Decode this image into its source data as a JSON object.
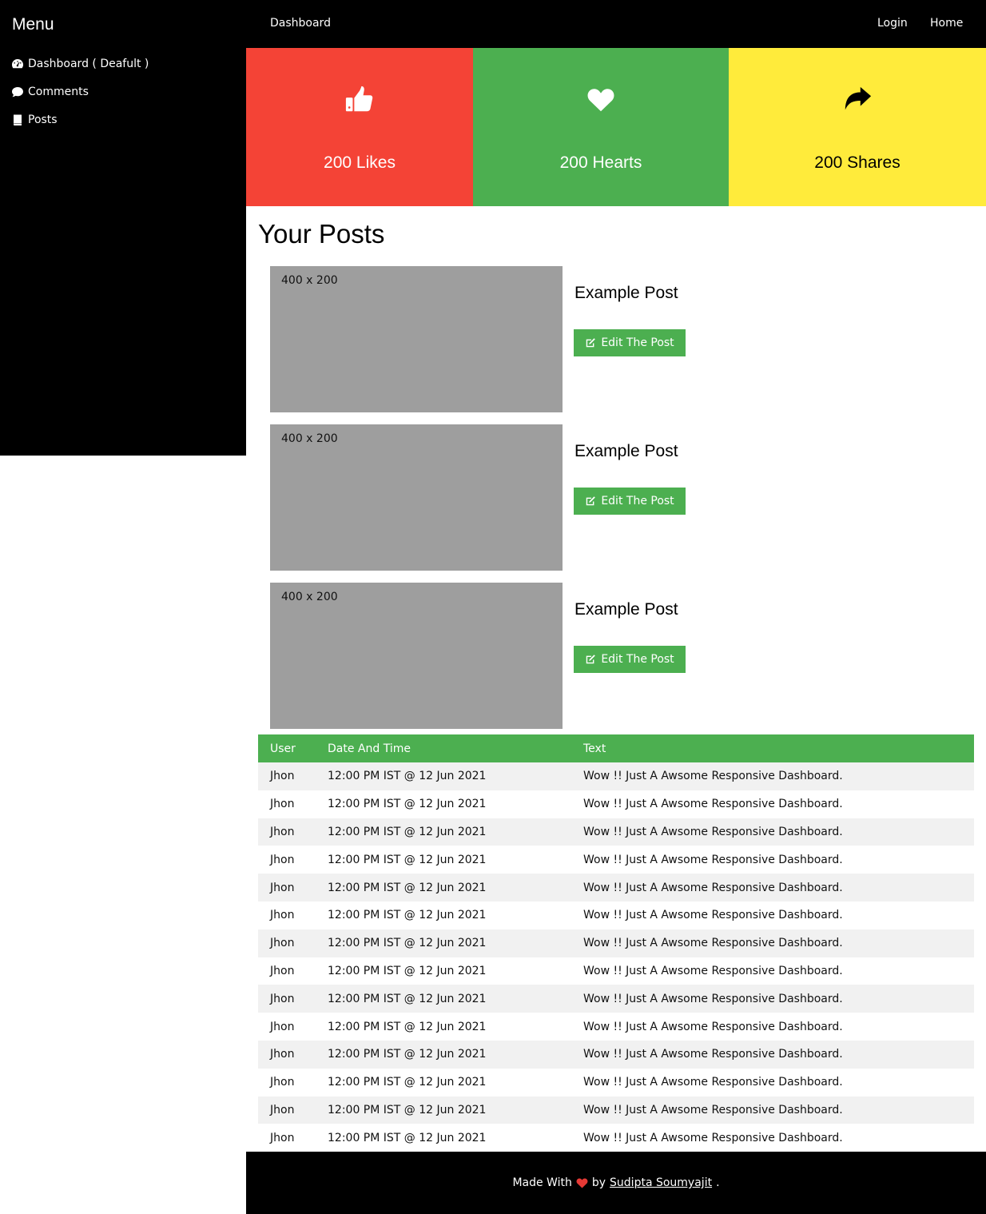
{
  "sidebar": {
    "title": "Menu",
    "items": [
      {
        "label": "Dashboard ( Deafult )",
        "icon": "tachometer-icon"
      },
      {
        "label": "Comments",
        "icon": "comment-icon"
      },
      {
        "label": "Posts",
        "icon": "book-icon"
      }
    ]
  },
  "topbar": {
    "title": "Dashboard",
    "links": [
      "Login",
      "Home"
    ]
  },
  "stats": [
    {
      "label": "200 Likes",
      "icon": "thumbs-up-icon",
      "color": "#f44336"
    },
    {
      "label": "200 Hearts",
      "icon": "heart-icon",
      "color": "#4caf50"
    },
    {
      "label": "200 Shares",
      "icon": "share-icon",
      "color": "#ffeb3b"
    }
  ],
  "posts": {
    "heading": "Your Posts",
    "items": [
      {
        "thumb_label": "400 x 200",
        "title": "Example Post",
        "button": "Edit The Post"
      },
      {
        "thumb_label": "400 x 200",
        "title": "Example Post",
        "button": "Edit The Post"
      },
      {
        "thumb_label": "400 x 200",
        "title": "Example Post",
        "button": "Edit The Post"
      }
    ]
  },
  "comments": {
    "headers": [
      "User",
      "Date And Time",
      "Text"
    ],
    "rows": [
      [
        "Jhon",
        "12:00 PM IST @ 12 Jun 2021",
        "Wow !! Just A Awsome Responsive Dashboard."
      ],
      [
        "Jhon",
        "12:00 PM IST @ 12 Jun 2021",
        "Wow !! Just A Awsome Responsive Dashboard."
      ],
      [
        "Jhon",
        "12:00 PM IST @ 12 Jun 2021",
        "Wow !! Just A Awsome Responsive Dashboard."
      ],
      [
        "Jhon",
        "12:00 PM IST @ 12 Jun 2021",
        "Wow !! Just A Awsome Responsive Dashboard."
      ],
      [
        "Jhon",
        "12:00 PM IST @ 12 Jun 2021",
        "Wow !! Just A Awsome Responsive Dashboard."
      ],
      [
        "Jhon",
        "12:00 PM IST @ 12 Jun 2021",
        "Wow !! Just A Awsome Responsive Dashboard."
      ],
      [
        "Jhon",
        "12:00 PM IST @ 12 Jun 2021",
        "Wow !! Just A Awsome Responsive Dashboard."
      ],
      [
        "Jhon",
        "12:00 PM IST @ 12 Jun 2021",
        "Wow !! Just A Awsome Responsive Dashboard."
      ],
      [
        "Jhon",
        "12:00 PM IST @ 12 Jun 2021",
        "Wow !! Just A Awsome Responsive Dashboard."
      ],
      [
        "Jhon",
        "12:00 PM IST @ 12 Jun 2021",
        "Wow !! Just A Awsome Responsive Dashboard."
      ],
      [
        "Jhon",
        "12:00 PM IST @ 12 Jun 2021",
        "Wow !! Just A Awsome Responsive Dashboard."
      ],
      [
        "Jhon",
        "12:00 PM IST @ 12 Jun 2021",
        "Wow !! Just A Awsome Responsive Dashboard."
      ],
      [
        "Jhon",
        "12:00 PM IST @ 12 Jun 2021",
        "Wow !! Just A Awsome Responsive Dashboard."
      ],
      [
        "Jhon",
        "12:00 PM IST @ 12 Jun 2021",
        "Wow !! Just A Awsome Responsive Dashboard."
      ]
    ]
  },
  "footer": {
    "prefix": "Made With",
    "by": "by",
    "author": "Sudipta Soumyajit",
    "suffix": "."
  }
}
